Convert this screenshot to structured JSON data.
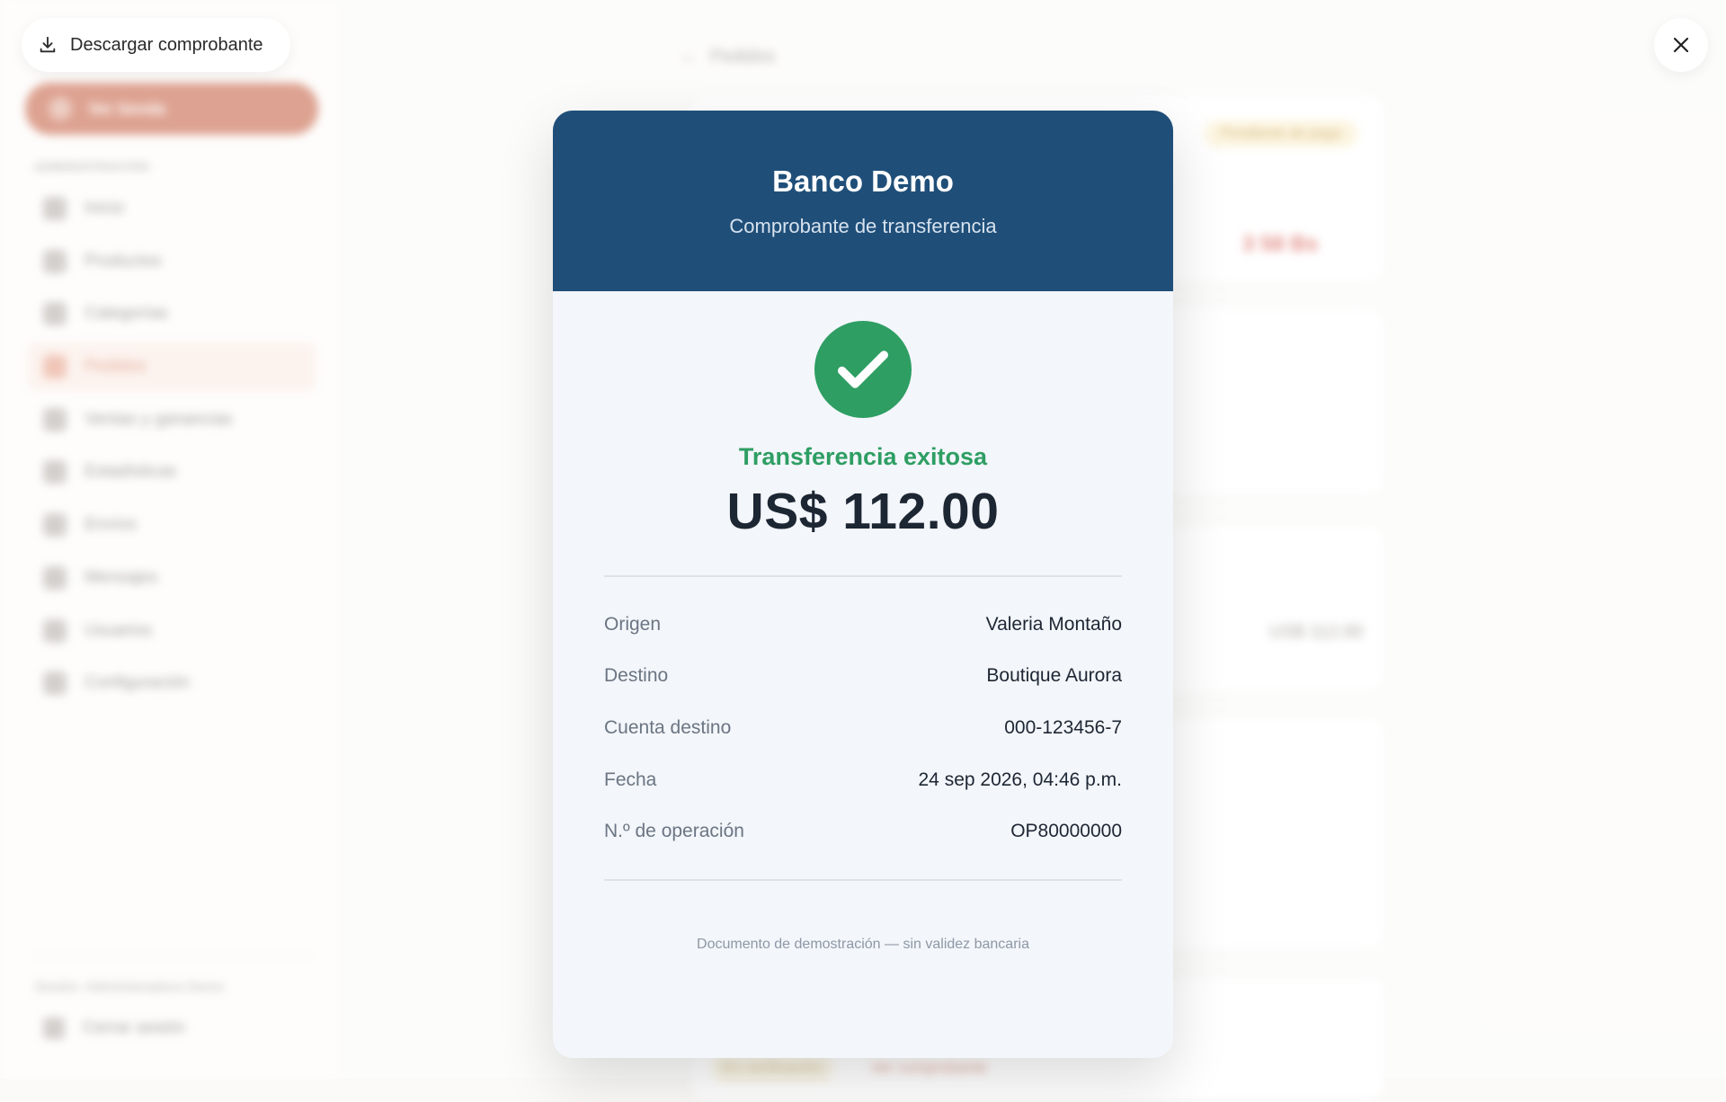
{
  "background": {
    "sidebar": {
      "store_button": "Ver tienda",
      "section_label": "ADMINISTRACIÓN",
      "items": [
        {
          "label": "Inicio",
          "icon": "grid-icon"
        },
        {
          "label": "Productos",
          "icon": "box-icon"
        },
        {
          "label": "Categorías",
          "icon": "tag-icon"
        },
        {
          "label": "Pedidos",
          "icon": "cart-icon",
          "active": true
        },
        {
          "label": "Ventas y ganancias",
          "icon": "trend-icon"
        },
        {
          "label": "Estadísticas",
          "icon": "chart-icon"
        },
        {
          "label": "Envíos",
          "icon": "truck-icon"
        },
        {
          "label": "Mensajes",
          "icon": "message-icon"
        },
        {
          "label": "Usuarios",
          "icon": "users-icon"
        },
        {
          "label": "Configuración",
          "icon": "gear-icon"
        }
      ],
      "user_line": "Sesión: Administradora Demo",
      "logout": "Cerrar sesión"
    },
    "main": {
      "back_link": "Pedidos",
      "badge": "Pendiente de pago",
      "amount_red": "3 58 Bs",
      "amount_grey": "US$ 112.00",
      "chips": [
        "En verificación",
        "Ver comprobante"
      ]
    }
  },
  "controls": {
    "download_label": "Descargar comprobante",
    "download_icon": "download-icon",
    "close_icon": "close-icon"
  },
  "receipt": {
    "bank_name": "Banco Demo",
    "subtitle": "Comprobante de transferencia",
    "status": "Transferencia exitosa",
    "amount": "US$ 112.00",
    "details": [
      {
        "label": "Origen",
        "value": "Valeria Montaño"
      },
      {
        "label": "Destino",
        "value": "Boutique Aurora"
      },
      {
        "label": "Cuenta destino",
        "value": "000-123456-7"
      },
      {
        "label": "Fecha",
        "value": "24 sep 2026, 04:46 p.m."
      },
      {
        "label": "N.º de operación",
        "value": "OP80000000"
      }
    ],
    "disclaimer": "Documento de demostración — sin validez bancaria"
  },
  "colors": {
    "header": "#1f4f79",
    "success": "#2e9e63",
    "accent": "#c96a4e"
  }
}
